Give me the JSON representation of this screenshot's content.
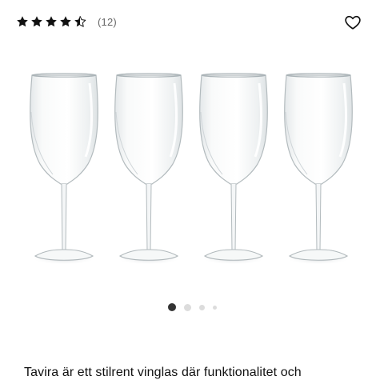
{
  "rating": {
    "value": 4.5,
    "max": 5,
    "review_count": "(12)",
    "star_color": "#111111"
  },
  "favorite": {
    "icon": "heart-outline-icon"
  },
  "gallery": {
    "image": "four-wine-glasses",
    "slide_count": 4,
    "active_slide": 1
  },
  "description": {
    "text": "Tavira är ett stilrent vinglas där funktionalitet och"
  }
}
